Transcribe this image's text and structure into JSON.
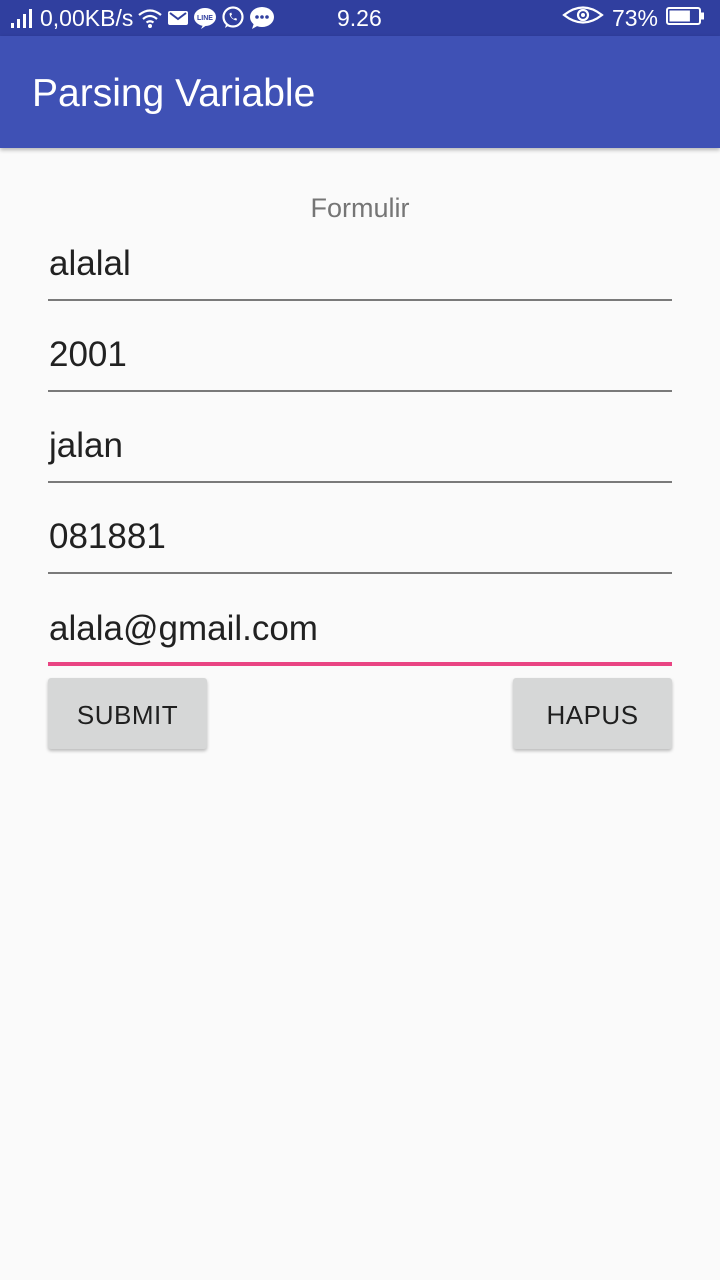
{
  "status_bar": {
    "network_speed": "0,00KB/s",
    "time": "9.26",
    "battery_percent": "73%",
    "battery_level": 0.73,
    "left_icons": [
      "signal-icon",
      "wifi-icon",
      "gmail-icon",
      "line-icon",
      "whatsapp-icon",
      "chat-bubble-icon"
    ],
    "right_icons": [
      "eye-icon",
      "battery-icon"
    ]
  },
  "app_bar": {
    "title": "Parsing Variable"
  },
  "form": {
    "header": "Formulir",
    "fields": [
      {
        "value": "alalal"
      },
      {
        "value": "2001"
      },
      {
        "value": "jalan"
      },
      {
        "value": "081881"
      },
      {
        "value": "alala@gmail.com",
        "focused": true
      }
    ],
    "submit_label": "SUBMIT",
    "clear_label": "HAPUS"
  },
  "colors": {
    "primary": "#3f51b5",
    "primary_dark": "#303f9f",
    "accent": "#e94483",
    "background": "#fafafa",
    "button": "#d6d7d7"
  }
}
